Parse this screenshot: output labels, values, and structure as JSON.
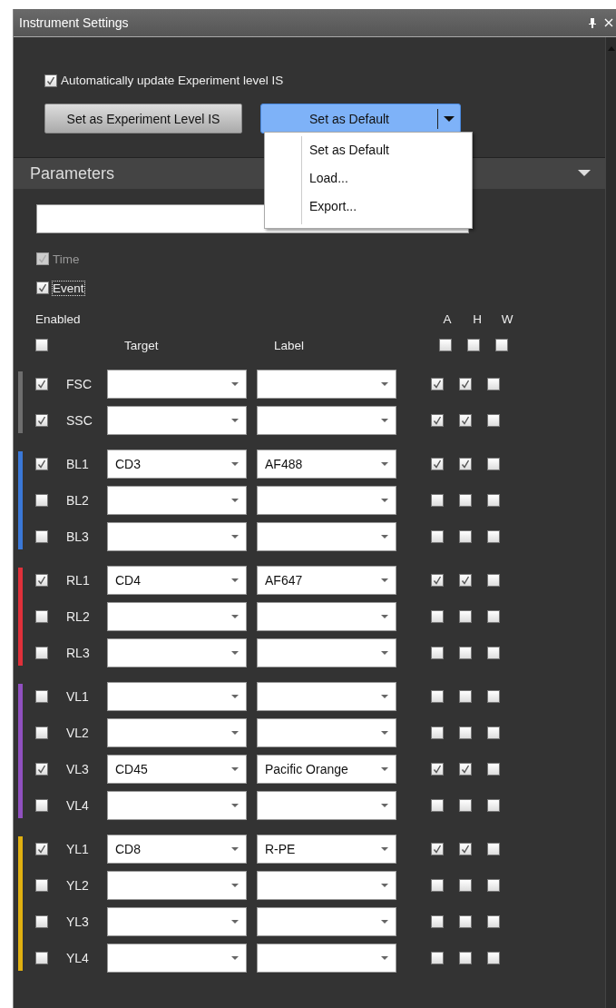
{
  "window": {
    "title": "Instrument Settings"
  },
  "auto_update": {
    "label": "Automatically update Experiment level IS",
    "checked": true
  },
  "buttons": {
    "experiment": "Set as Experiment Level IS",
    "default": "Set as Default"
  },
  "menu": [
    {
      "label": "Set as Default"
    },
    {
      "label": "Load..."
    },
    {
      "label": "Export..."
    }
  ],
  "section": {
    "title": "Parameters"
  },
  "options": [
    {
      "label": "Time",
      "checked": true,
      "disabled": true,
      "focused": false
    },
    {
      "label": "Event",
      "checked": true,
      "disabled": false,
      "focused": true
    }
  ],
  "header": {
    "enabled": "Enabled",
    "target": "Target",
    "label": "Label",
    "columns": [
      {
        "label": "A",
        "checked": false
      },
      {
        "label": "H",
        "checked": false
      },
      {
        "label": "W",
        "checked": false
      }
    ],
    "enabled_checked": false
  },
  "groups": [
    {
      "color": "#6e6e6e",
      "channels": [
        {
          "name": "FSC",
          "enabled": true,
          "a": true,
          "h": true,
          "w": false
        },
        {
          "name": "SSC",
          "enabled": true,
          "a": true,
          "h": true,
          "w": false
        }
      ]
    },
    {
      "color": "#3a78d8",
      "channels": [
        {
          "name": "BL1",
          "enabled": true,
          "target": "CD3",
          "label": "AF488",
          "a": true,
          "h": true,
          "w": false
        },
        {
          "name": "BL2",
          "enabled": false,
          "a": false,
          "h": false,
          "w": false
        },
        {
          "name": "BL3",
          "enabled": false,
          "a": false,
          "h": false,
          "w": false
        }
      ]
    },
    {
      "color": "#e0303a",
      "channels": [
        {
          "name": "RL1",
          "enabled": true,
          "target": "CD4",
          "label": "AF647",
          "a": true,
          "h": true,
          "w": false
        },
        {
          "name": "RL2",
          "enabled": false,
          "a": false,
          "h": false,
          "w": false
        },
        {
          "name": "RL3",
          "enabled": false,
          "a": false,
          "h": false,
          "w": false
        }
      ]
    },
    {
      "color": "#9050c0",
      "channels": [
        {
          "name": "VL1",
          "enabled": false,
          "a": false,
          "h": false,
          "w": false
        },
        {
          "name": "VL2",
          "enabled": false,
          "a": false,
          "h": false,
          "w": false
        },
        {
          "name": "VL3",
          "enabled": true,
          "target": "CD45",
          "label": "Pacific Orange",
          "a": true,
          "h": true,
          "w": false
        },
        {
          "name": "VL4",
          "enabled": false,
          "a": false,
          "h": false,
          "w": false
        }
      ]
    },
    {
      "color": "#e0b010",
      "channels": [
        {
          "name": "YL1",
          "enabled": true,
          "target": "CD8",
          "label": "R-PE",
          "a": true,
          "h": true,
          "w": false
        },
        {
          "name": "YL2",
          "enabled": false,
          "a": false,
          "h": false,
          "w": false
        },
        {
          "name": "YL3",
          "enabled": false,
          "a": false,
          "h": false,
          "w": false
        },
        {
          "name": "YL4",
          "enabled": false,
          "a": false,
          "h": false,
          "w": false
        }
      ]
    }
  ]
}
